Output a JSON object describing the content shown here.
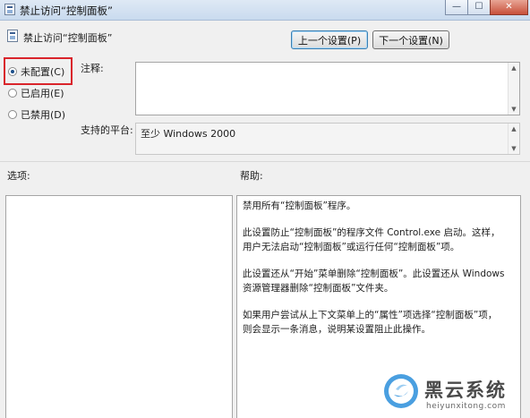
{
  "window": {
    "title": "禁止访问“控制面板”",
    "minimize_glyph": "—",
    "maximize_glyph": "☐",
    "close_glyph": "✕"
  },
  "header": {
    "policy_name": "禁止访问“控制面板”",
    "prev_button": "上一个设置(P)",
    "next_button": "下一个设置(N)"
  },
  "state_options": {
    "selected": "not_configured",
    "items": [
      {
        "id": "not_configured",
        "label": "未配置(C)",
        "checked": true
      },
      {
        "id": "enabled",
        "label": "已启用(E)",
        "checked": false
      },
      {
        "id": "disabled",
        "label": "已禁用(D)",
        "checked": false
      }
    ],
    "highlight_color": "#d9242b"
  },
  "comment": {
    "label": "注释:",
    "value": ""
  },
  "platform": {
    "label": "支持的平台:",
    "value": "至少 Windows 2000"
  },
  "options": {
    "label": "选项:"
  },
  "help": {
    "label": "帮助:",
    "paragraphs": [
      "禁用所有“控制面板”程序。",
      "此设置防止“控制面板”的程序文件 Control.exe 启动。这样，用户无法启动“控制面板”或运行任何“控制面板”项。",
      "此设置还从“开始”菜单删除“控制面板”。此设置还从 Windows 资源管理器删除“控制面板”文件夹。",
      "如果用户尝试从上下文菜单上的“属性”项选择“控制面板”项，则会显示一条消息，说明某设置阻止此操作。"
    ]
  },
  "watermark": {
    "brand": "黑云系统",
    "url": "heiyunxitong.com",
    "color": "#4a9fe0"
  }
}
